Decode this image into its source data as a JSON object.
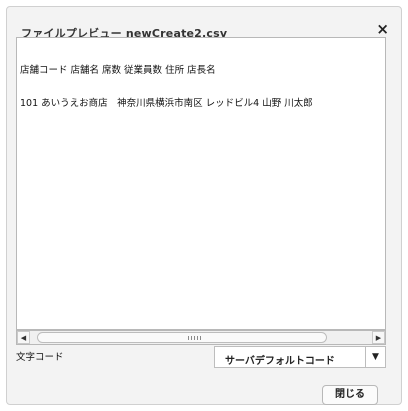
{
  "dialog": {
    "title": "ファイルプレビュー newCreate2.csv",
    "close_glyph": "×"
  },
  "preview": {
    "lines": [
      "店舗コード 店舗名 席数 従業員数 住所 店長名",
      "101 あいうえお商店　神奈川県横浜市南区 レッドビル4 山野 川太郎"
    ]
  },
  "scrollbar": {
    "left_arrow": "◀",
    "right_arrow": "▶"
  },
  "encoding": {
    "label": "文字コード",
    "selected": "サーバデフォルトコード",
    "arrow": "▼"
  },
  "footer": {
    "close_label": "閉じる"
  }
}
